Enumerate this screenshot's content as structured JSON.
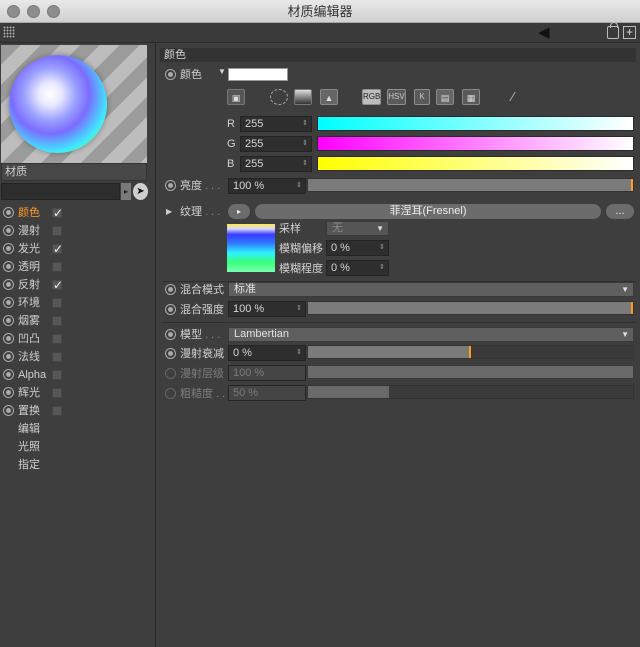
{
  "window": {
    "title": "材质编辑器"
  },
  "left": {
    "material_label": "材质",
    "channels": [
      {
        "label": "颜色",
        "checked": true,
        "active": true
      },
      {
        "label": "漫射",
        "checked": false,
        "active": false
      },
      {
        "label": "发光",
        "checked": true,
        "active": false
      },
      {
        "label": "透明",
        "checked": false,
        "active": false
      },
      {
        "label": "反射",
        "checked": true,
        "active": false
      },
      {
        "label": "环境",
        "checked": false,
        "active": false
      },
      {
        "label": "烟雾",
        "checked": false,
        "active": false
      },
      {
        "label": "凹凸",
        "checked": false,
        "active": false
      },
      {
        "label": "法线",
        "checked": false,
        "active": false
      },
      {
        "label": "Alpha",
        "checked": false,
        "active": false
      },
      {
        "label": "辉光",
        "checked": false,
        "active": false
      },
      {
        "label": "置换",
        "checked": false,
        "active": false
      }
    ],
    "extra_items": [
      "编辑",
      "光照",
      "指定"
    ]
  },
  "color": {
    "section_title": "颜色",
    "color_label": "颜色",
    "swatch_color": "#ffffff",
    "modes": [
      "RGB",
      "HSV",
      "K"
    ],
    "r_label": "R",
    "r_value": "255",
    "g_label": "G",
    "g_value": "255",
    "b_label": "B",
    "b_value": "255",
    "brightness_label": "亮度",
    "brightness_value": "100 %",
    "brightness_fraction": 1.0,
    "texture_label": "纹理",
    "texture_name": "菲涅耳(Fresnel)",
    "texture_more": "...",
    "sampling_label": "采样",
    "sampling_value": "无",
    "blur_offset_label": "模糊偏移",
    "blur_offset_value": "0 %",
    "blur_scale_label": "模糊程度",
    "blur_scale_value": "0 %",
    "mix_mode_label": "混合模式",
    "mix_mode_value": "标准",
    "mix_strength_label": "混合强度",
    "mix_strength_value": "100 %",
    "mix_strength_fraction": 1.0,
    "model_label": "模型",
    "model_value": "Lambertian",
    "diffuse_falloff_label": "漫射衰减",
    "diffuse_falloff_value": "0 %",
    "diffuse_falloff_fraction": 0.5,
    "diffuse_level_label": "漫射层级",
    "diffuse_level_value": "100 %",
    "roughness_label": "粗糙度",
    "roughness_value": "50 %",
    "roughness_fraction": 0.25
  },
  "colors": {
    "accent": "#ff9b1e",
    "active_label": "#ff9b2a",
    "r_gradient_end": "#00ffff",
    "g_gradient_end": "#ff00ff",
    "b_gradient_end": "#ffff00"
  }
}
